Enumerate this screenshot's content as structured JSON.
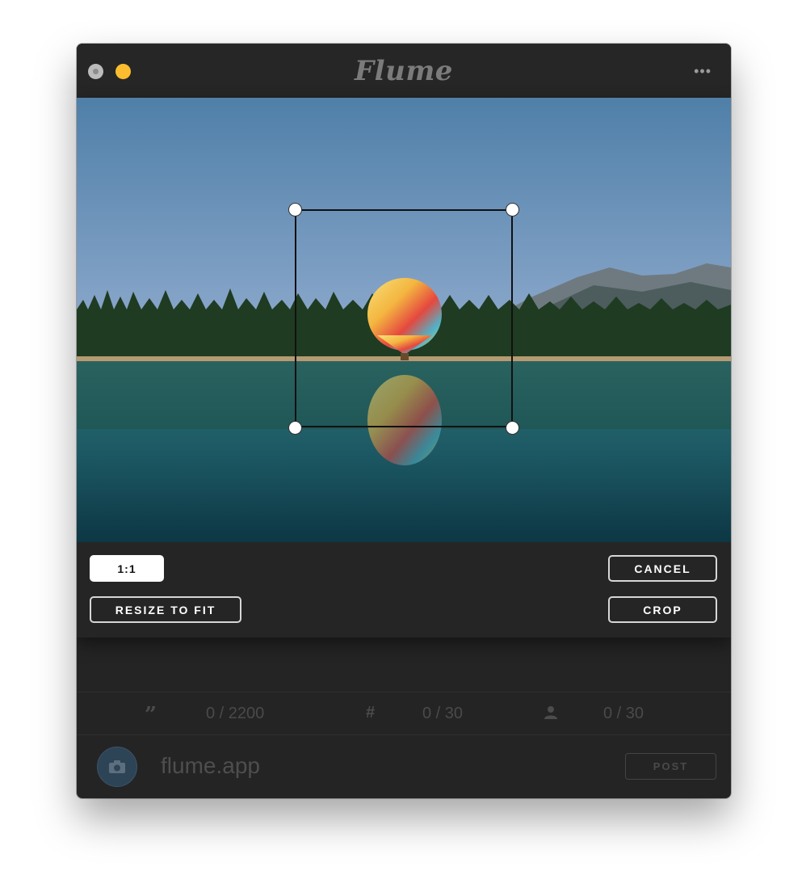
{
  "app": {
    "title": "Flume"
  },
  "titlebar": {
    "more_label": "•••"
  },
  "crop": {
    "aspect_label": "1:1",
    "resize_label": "RESIZE TO FIT",
    "cancel_label": "CANCEL",
    "crop_label": "CROP"
  },
  "counters": {
    "caption": "0 / 2200",
    "hashtags": "0 / 30",
    "mentions": "0 / 30"
  },
  "footer": {
    "account": "flume.app",
    "post_label": "POST"
  },
  "colors": {
    "window_bg": "#242424",
    "traffic_close": "#bcbcbc",
    "traffic_minimize": "#fbbd2f",
    "button_border": "#d6d6d6"
  },
  "icons": [
    "more-icon",
    "quote-icon",
    "hashtag-icon",
    "user-icon",
    "camera-icon"
  ]
}
